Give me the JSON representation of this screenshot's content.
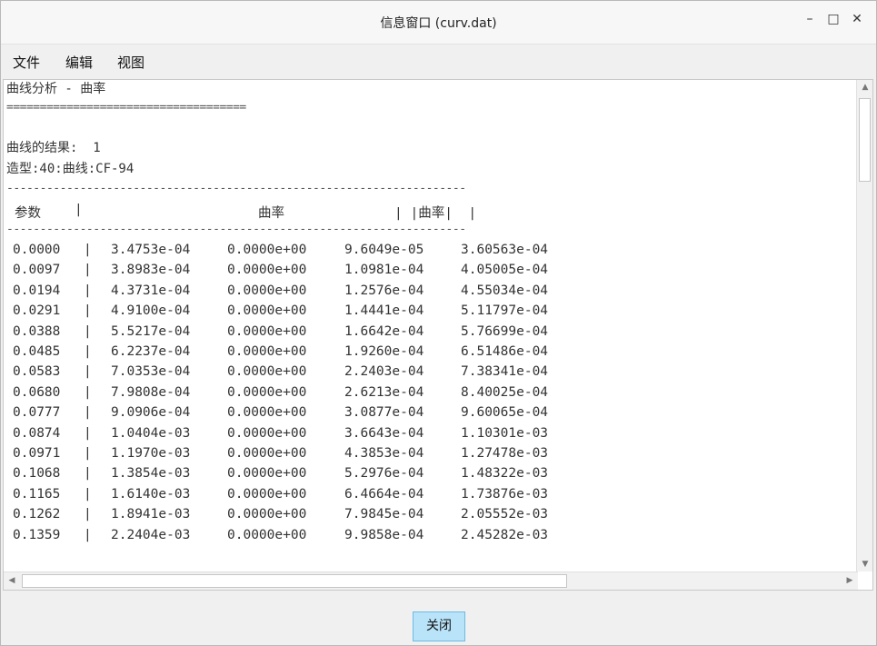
{
  "window": {
    "title": "信息窗口 (curv.dat)",
    "minimize": "–",
    "maximize": "□",
    "close": "✕"
  },
  "menu": [
    "文件",
    "编辑",
    "视图"
  ],
  "content": {
    "heading": "曲线分析 - 曲率",
    "rule_eq": "====================================",
    "result_label": "曲线的结果:  1",
    "feature": "造型:40:曲线:CF-94",
    "rule_dash": "---------------------------------------------------------------------",
    "headers": {
      "param": "参数",
      "sep1": "|",
      "curv": "曲率",
      "sep2": "| |曲率|  |"
    },
    "rows": [
      [
        "0.0000",
        "|",
        "3.4753e-04",
        "0.0000e+00",
        "9.6049e-05",
        "3.60563e-04"
      ],
      [
        "0.0097",
        "|",
        "3.8983e-04",
        "0.0000e+00",
        "1.0981e-04",
        "4.05005e-04"
      ],
      [
        "0.0194",
        "|",
        "4.3731e-04",
        "0.0000e+00",
        "1.2576e-04",
        "4.55034e-04"
      ],
      [
        "0.0291",
        "|",
        "4.9100e-04",
        "0.0000e+00",
        "1.4441e-04",
        "5.11797e-04"
      ],
      [
        "0.0388",
        "|",
        "5.5217e-04",
        "0.0000e+00",
        "1.6642e-04",
        "5.76699e-04"
      ],
      [
        "0.0485",
        "|",
        "6.2237e-04",
        "0.0000e+00",
        "1.9260e-04",
        "6.51486e-04"
      ],
      [
        "0.0583",
        "|",
        "7.0353e-04",
        "0.0000e+00",
        "2.2403e-04",
        "7.38341e-04"
      ],
      [
        "0.0680",
        "|",
        "7.9808e-04",
        "0.0000e+00",
        "2.6213e-04",
        "8.40025e-04"
      ],
      [
        "0.0777",
        "|",
        "9.0906e-04",
        "0.0000e+00",
        "3.0877e-04",
        "9.60065e-04"
      ],
      [
        "0.0874",
        "|",
        "1.0404e-03",
        "0.0000e+00",
        "3.6643e-04",
        "1.10301e-03"
      ],
      [
        "0.0971",
        "|",
        "1.1970e-03",
        "0.0000e+00",
        "4.3853e-04",
        "1.27478e-03"
      ],
      [
        "0.1068",
        "|",
        "1.3854e-03",
        "0.0000e+00",
        "5.2976e-04",
        "1.48322e-03"
      ],
      [
        "0.1165",
        "|",
        "1.6140e-03",
        "0.0000e+00",
        "6.4664e-04",
        "1.73876e-03"
      ],
      [
        "0.1262",
        "|",
        "1.8941e-03",
        "0.0000e+00",
        "7.9845e-04",
        "2.05552e-03"
      ],
      [
        "0.1359",
        "|",
        "2.2404e-03",
        "0.0000e+00",
        "9.9858e-04",
        "2.45282e-03"
      ]
    ]
  },
  "buttons": {
    "close": "关闭"
  }
}
